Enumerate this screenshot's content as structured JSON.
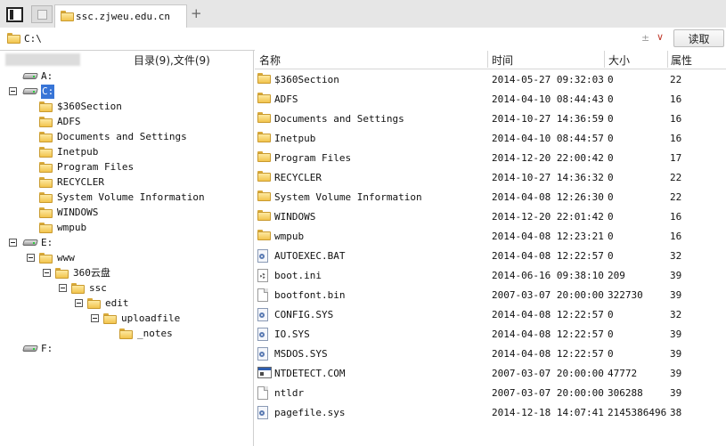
{
  "tab": {
    "title": "ssc.zjweu.edu.cn",
    "add_label": "+"
  },
  "address": {
    "value": "C:\\",
    "pin_glyph": "±",
    "dropdown_glyph": "∨",
    "read_label": "读取"
  },
  "tree": {
    "header": "目录(9),文件(9)",
    "items": [
      {
        "label": "A:",
        "icon": "drive-icon",
        "expander": false
      },
      {
        "label": "C:",
        "icon": "drive-icon",
        "expander": true,
        "selected": true
      },
      {
        "label": "$360Section",
        "icon": "folder-icon"
      },
      {
        "label": "ADFS",
        "icon": "folder-icon"
      },
      {
        "label": "Documents and Settings",
        "icon": "folder-icon"
      },
      {
        "label": "Inetpub",
        "icon": "folder-icon"
      },
      {
        "label": "Program Files",
        "icon": "folder-icon"
      },
      {
        "label": "RECYCLER",
        "icon": "folder-icon"
      },
      {
        "label": "System Volume Information",
        "icon": "folder-icon"
      },
      {
        "label": "WINDOWS",
        "icon": "folder-icon"
      },
      {
        "label": "wmpub",
        "icon": "folder-icon"
      },
      {
        "label": "E:",
        "icon": "drive-icon",
        "expander": true
      },
      {
        "label": "www",
        "icon": "folder-icon",
        "expander": true
      },
      {
        "label": "360云盘",
        "icon": "folder-icon",
        "expander": true
      },
      {
        "label": "ssc",
        "icon": "folder-icon",
        "expander": true
      },
      {
        "label": "edit",
        "icon": "folder-icon",
        "expander": true
      },
      {
        "label": "uploadfile",
        "icon": "folder-icon",
        "expander": true
      },
      {
        "label": "_notes",
        "icon": "folder-icon"
      },
      {
        "label": "F:",
        "icon": "drive-icon",
        "expander": false
      }
    ]
  },
  "list": {
    "columns": {
      "name": "名称",
      "time": "时间",
      "size": "大小",
      "attr": "属性"
    },
    "rows": [
      {
        "name": "$360Section",
        "time": "2014-05-27 09:32:03",
        "size": "0",
        "attr": "22",
        "icon": "folder-icon"
      },
      {
        "name": "ADFS",
        "time": "2014-04-10 08:44:43",
        "size": "0",
        "attr": "16",
        "icon": "folder-icon"
      },
      {
        "name": "Documents and Settings",
        "time": "2014-10-27 14:36:59",
        "size": "0",
        "attr": "16",
        "icon": "folder-icon"
      },
      {
        "name": "Inetpub",
        "time": "2014-04-10 08:44:57",
        "size": "0",
        "attr": "16",
        "icon": "folder-icon"
      },
      {
        "name": "Program Files",
        "time": "2014-12-20 22:00:42",
        "size": "0",
        "attr": "17",
        "icon": "folder-icon"
      },
      {
        "name": "RECYCLER",
        "time": "2014-10-27 14:36:32",
        "size": "0",
        "attr": "22",
        "icon": "folder-icon"
      },
      {
        "name": "System Volume Information",
        "time": "2014-04-08 12:26:30",
        "size": "0",
        "attr": "22",
        "icon": "folder-icon"
      },
      {
        "name": "WINDOWS",
        "time": "2014-12-20 22:01:42",
        "size": "0",
        "attr": "16",
        "icon": "folder-icon"
      },
      {
        "name": "wmpub",
        "time": "2014-04-08 12:23:21",
        "size": "0",
        "attr": "16",
        "icon": "folder-icon"
      },
      {
        "name": "AUTOEXEC.BAT",
        "time": "2014-04-08 12:22:57",
        "size": "0",
        "attr": "32",
        "icon": "system-file-icon"
      },
      {
        "name": "boot.ini",
        "time": "2014-06-16 09:38:10",
        "size": "209",
        "attr": "39",
        "icon": "settings-file-icon"
      },
      {
        "name": "bootfont.bin",
        "time": "2007-03-07 20:00:00",
        "size": "322730",
        "attr": "39",
        "icon": "file-icon"
      },
      {
        "name": "CONFIG.SYS",
        "time": "2014-04-08 12:22:57",
        "size": "0",
        "attr": "32",
        "icon": "system-file-icon"
      },
      {
        "name": "IO.SYS",
        "time": "2014-04-08 12:22:57",
        "size": "0",
        "attr": "39",
        "icon": "system-file-icon"
      },
      {
        "name": "MSDOS.SYS",
        "time": "2014-04-08 12:22:57",
        "size": "0",
        "attr": "39",
        "icon": "system-file-icon"
      },
      {
        "name": "NTDETECT.COM",
        "time": "2007-03-07 20:00:00",
        "size": "47772",
        "attr": "39",
        "icon": "executable-icon"
      },
      {
        "name": "ntldr",
        "time": "2007-03-07 20:00:00",
        "size": "306288",
        "attr": "39",
        "icon": "file-icon"
      },
      {
        "name": "pagefile.sys",
        "time": "2014-12-18 14:07:41",
        "size": "2145386496",
        "attr": "38",
        "icon": "system-file-icon"
      }
    ]
  }
}
